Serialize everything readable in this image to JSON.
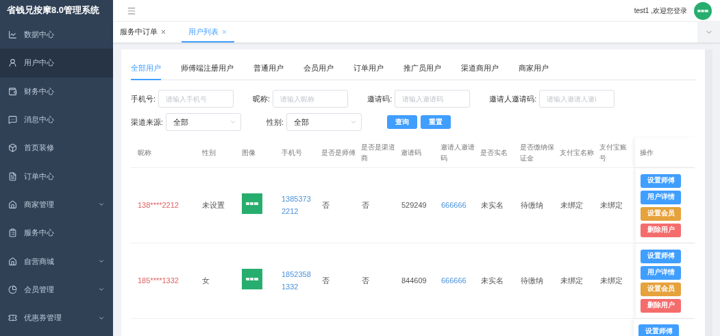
{
  "app_title": "省钱兄按摩8.0管理系统",
  "sidebar": {
    "items": [
      {
        "label": "数据中心",
        "selected": false,
        "expandable": false
      },
      {
        "label": "用户中心",
        "selected": true,
        "expandable": false
      },
      {
        "label": "财务中心",
        "selected": false,
        "expandable": false
      },
      {
        "label": "消息中心",
        "selected": false,
        "expandable": false
      },
      {
        "label": "首页装修",
        "selected": false,
        "expandable": false
      },
      {
        "label": "订单中心",
        "selected": false,
        "expandable": false
      },
      {
        "label": "商家管理",
        "selected": false,
        "expandable": true
      },
      {
        "label": "服务中心",
        "selected": false,
        "expandable": false
      },
      {
        "label": "自营商城",
        "selected": false,
        "expandable": true
      },
      {
        "label": "会员管理",
        "selected": false,
        "expandable": true
      },
      {
        "label": "优惠券管理",
        "selected": false,
        "expandable": true
      }
    ]
  },
  "header": {
    "greeting": "test1 ,欢迎您登录"
  },
  "page_tabs": [
    {
      "label": "服务中订单",
      "selected": false
    },
    {
      "label": "用户列表",
      "selected": true
    }
  ],
  "user_tabs": [
    {
      "label": "全部用户",
      "selected": true
    },
    {
      "label": "师傅端注册用户",
      "selected": false
    },
    {
      "label": "普通用户",
      "selected": false
    },
    {
      "label": "会员用户",
      "selected": false
    },
    {
      "label": "订单用户",
      "selected": false
    },
    {
      "label": "推广员用户",
      "selected": false
    },
    {
      "label": "渠道商用户",
      "selected": false
    },
    {
      "label": "商家用户",
      "selected": false
    }
  ],
  "filters": [
    [
      {
        "kind": "input",
        "label": "手机号:",
        "placeholder": "请输入手机号"
      },
      {
        "kind": "input",
        "label": "昵称:",
        "placeholder": "请输入昵称"
      },
      {
        "kind": "input",
        "label": "邀请码:",
        "placeholder": "请输入邀请码"
      },
      {
        "kind": "input",
        "label": "邀请人邀请码:",
        "placeholder": "请输入邀请人邀i"
      }
    ],
    [
      {
        "kind": "select",
        "label": "渠道来源:",
        "value": "全部"
      },
      {
        "kind": "select",
        "label": "性别:",
        "value": "全部"
      }
    ]
  ],
  "filter_buttons": [
    "查询",
    "重置"
  ],
  "table": {
    "columns": [
      {
        "label": "昵称",
        "kind": "masked"
      },
      {
        "label": "性别",
        "kind": "text"
      },
      {
        "label": "图像"
      },
      {
        "label": "手机号",
        "kind": "phone"
      },
      {
        "label": "是否是师傅",
        "kind": "text"
      },
      {
        "label": "是否是渠道商",
        "kind": "text"
      },
      {
        "label": "邀请码",
        "kind": "text"
      },
      {
        "label": "邀请人邀请码",
        "kind": "link"
      },
      {
        "label": "是否实名",
        "kind": "text"
      },
      {
        "label": "是否缴纳保证金",
        "kind": "text"
      },
      {
        "label": "支付宝名称",
        "kind": "text"
      },
      {
        "label": "支付宝账号",
        "kind": "text"
      }
    ],
    "actions_header": "操作",
    "rows": [
      {
        "cells": [
          "138****2212",
          "未设置",
          {
            "kind": "picture"
          },
          "13853732212",
          "否",
          "否",
          "529249",
          "666666",
          "未实名",
          "待缴纳",
          "未绑定",
          "未绑定"
        ],
        "actions": [
          {
            "label": "设置师傅",
            "kind": "primary"
          },
          {
            "label": "用户详情",
            "kind": "primary"
          },
          {
            "label": "设置会员",
            "kind": "warning"
          },
          {
            "label": "删除用户",
            "kind": "danger"
          }
        ]
      },
      {
        "cells": [
          "185****1332",
          "女",
          {
            "kind": "picture"
          },
          "18523581332",
          "否",
          "否",
          "844609",
          "666666",
          "未实名",
          "待缴纳",
          "未绑定",
          "未绑定"
        ],
        "actions": [
          {
            "label": "设置师傅",
            "kind": "primary"
          },
          {
            "label": "用户详情",
            "kind": "primary"
          },
          {
            "label": "设置会员",
            "kind": "warning"
          },
          {
            "label": "删除用户",
            "kind": "danger"
          }
        ]
      },
      {
        "actions": [
          {
            "label": "设置师傅",
            "kind": "primary"
          }
        ]
      }
    ]
  }
}
